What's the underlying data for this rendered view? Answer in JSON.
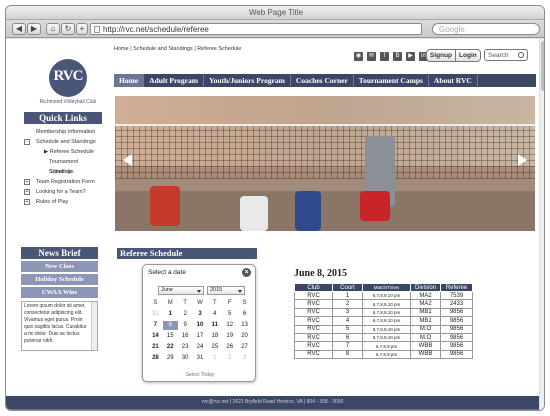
{
  "browser": {
    "title": "Web Page Title",
    "url": "http://rvc.net/schedule/referee",
    "search_placeholder": "Google",
    "buttons": [
      "◀",
      "▶",
      "⌂",
      "↻",
      "+"
    ]
  },
  "breadcrumb": "Home | Schedule and Standings | Referee Schedule",
  "logo": {
    "initials": "RVC",
    "name": "Richmond Volleyball Club"
  },
  "social_icons": [
    "rss-icon",
    "email-icon",
    "facebook-icon",
    "blogger-icon",
    "youtube-icon",
    "linkedin-icon"
  ],
  "auth": {
    "signup": "Signup",
    "login": "Login"
  },
  "site_search": {
    "label": "Search"
  },
  "nav": [
    "Home",
    "Adult Program",
    "Youth/Juniors Program",
    "Coaches Corner",
    "Tournament Camps",
    "About RVC"
  ],
  "quick_links": {
    "title": "Quick Links",
    "items": [
      {
        "label": "Membership Information",
        "indent": 0,
        "box": ""
      },
      {
        "label": "Schedule and Standings",
        "indent": 0,
        "box": "-"
      },
      {
        "label": "Referee Schedule",
        "indent": 1,
        "box": ""
      },
      {
        "label": "Tournament Schedule",
        "indent": 1,
        "box": ""
      },
      {
        "label": "Standings",
        "indent": 1,
        "box": ""
      },
      {
        "label": "Team Registration Form",
        "indent": 0,
        "box": "+"
      },
      {
        "label": "Looking for a Team?",
        "indent": 0,
        "box": "+"
      },
      {
        "label": "Rules of Play",
        "indent": 0,
        "box": "+"
      }
    ]
  },
  "news_brief": {
    "title": "News Brief",
    "links": [
      "New Class",
      "Holiday Schedule",
      "CWAA Wins"
    ],
    "text": "Lorem ipsum dolor sit amet, consectetur adipiscing elit. Vivamus eget purus. Proin quis sagittis lacus. Curabitur a mi dolor. Duis ac lectus pulvinar nibh."
  },
  "referee_schedule": {
    "title": "Referee Schedule"
  },
  "datepicker": {
    "title": "Select a date",
    "month": "June",
    "year": "2015",
    "day_headers": [
      "S",
      "M",
      "T",
      "W",
      "T",
      "F",
      "S"
    ],
    "days": [
      {
        "d": "31",
        "s": "gray"
      },
      {
        "d": "1",
        "s": "b"
      },
      {
        "d": "2",
        "s": ""
      },
      {
        "d": "3",
        "s": "b"
      },
      {
        "d": "4",
        "s": ""
      },
      {
        "d": "5",
        "s": ""
      },
      {
        "d": "6",
        "s": ""
      },
      {
        "d": "7",
        "s": "b"
      },
      {
        "d": "8",
        "s": "sel"
      },
      {
        "d": "9",
        "s": ""
      },
      {
        "d": "10",
        "s": "b"
      },
      {
        "d": "11",
        "s": "b"
      },
      {
        "d": "12",
        "s": ""
      },
      {
        "d": "13",
        "s": ""
      },
      {
        "d": "14",
        "s": "b"
      },
      {
        "d": "15",
        "s": ""
      },
      {
        "d": "16",
        "s": ""
      },
      {
        "d": "17",
        "s": ""
      },
      {
        "d": "18",
        "s": ""
      },
      {
        "d": "19",
        "s": ""
      },
      {
        "d": "20",
        "s": ""
      },
      {
        "d": "21",
        "s": "b"
      },
      {
        "d": "22",
        "s": "b"
      },
      {
        "d": "23",
        "s": ""
      },
      {
        "d": "24",
        "s": ""
      },
      {
        "d": "25",
        "s": ""
      },
      {
        "d": "26",
        "s": ""
      },
      {
        "d": "27",
        "s": ""
      },
      {
        "d": "28",
        "s": "b"
      },
      {
        "d": "29",
        "s": ""
      },
      {
        "d": "30",
        "s": ""
      },
      {
        "d": "31",
        "s": ""
      },
      {
        "d": "1",
        "s": "gray"
      },
      {
        "d": "2",
        "s": "gray"
      },
      {
        "d": "3",
        "s": "gray"
      }
    ],
    "today_label": "Select Today"
  },
  "schedule": {
    "date": "June 8, 2015",
    "headers": [
      "Club",
      "Court",
      "Match/Times",
      "Division",
      "Referee"
    ],
    "rows": [
      [
        "RVC",
        "1",
        "6,7,8,9,10 pm",
        "MA2",
        "7539"
      ],
      [
        "RVC",
        "2",
        "6,7,8,9,10 pm",
        "MA2",
        "2433"
      ],
      [
        "RVC",
        "3",
        "6,7,8,9,10 pm",
        "MB1",
        "9856"
      ],
      [
        "RVC",
        "4",
        "6,7,8,9,10 pm",
        "MB1",
        "9856"
      ],
      [
        "RVC",
        "5",
        "6,7,8,9,10 pm",
        "M.O",
        "9856"
      ],
      [
        "RVC",
        "6",
        "6,7,8,9,10 pm",
        "M.O",
        "9856"
      ],
      [
        "RVC",
        "7",
        "6,7,8,9 pm",
        "WBB",
        "9856"
      ],
      [
        "RVC",
        "8",
        "6,7,8,9 pm",
        "WBB",
        "9856"
      ]
    ]
  },
  "footer": "rvc@rvc.net | 2621 Bryfield Road Henrico, VA | 804 - 358 - 3000",
  "colors": {
    "navy": "#3c4766",
    "slate": "#4a5677",
    "lavender": "#8e96b6"
  }
}
